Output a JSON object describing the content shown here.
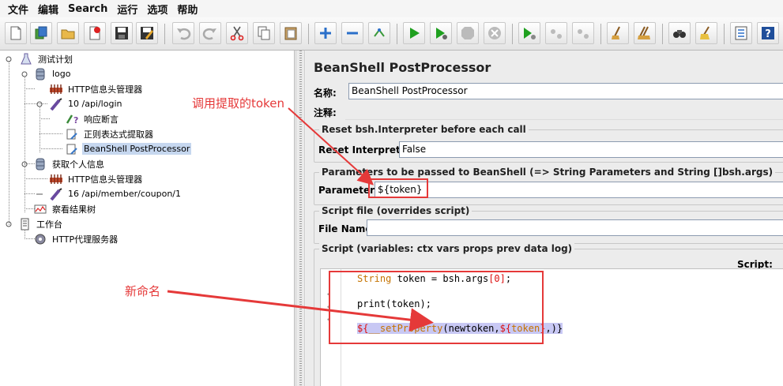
{
  "menu": {
    "items": [
      "文件",
      "编辑",
      "Search",
      "运行",
      "选项",
      "帮助"
    ]
  },
  "toolbar": {
    "icons": [
      "new-file-icon",
      "templates-icon",
      "open-icon",
      "close-plan-icon",
      "save-icon",
      "save-as-icon",
      "undo-icon",
      "redo-icon",
      "cut-icon",
      "copy-icon",
      "paste-icon",
      "expand-icon",
      "collapse-icon",
      "toggle-icon",
      "start-icon",
      "start-no-pause-icon",
      "stop-icon",
      "shutdown-icon",
      "remote-start-icon",
      "remote-stop-icon",
      "remote-shutdown-icon",
      "clear-icon",
      "clear-all-icon",
      "search-icon",
      "reset-search-icon",
      "function-helper-icon",
      "help-icon"
    ]
  },
  "tree": {
    "nodes": [
      {
        "label": "测试计划",
        "icon": "test-plan-icon"
      },
      {
        "label": "logo",
        "icon": "thread-group-icon"
      },
      {
        "label": "HTTP信息头管理器",
        "icon": "header-manager-icon"
      },
      {
        "label": "10 /api/login",
        "icon": "sampler-icon"
      },
      {
        "label": "响应断言",
        "icon": "assertion-icon"
      },
      {
        "label": "正则表达式提取器",
        "icon": "extractor-icon"
      },
      {
        "label": "BeanShell PostProcessor",
        "icon": "postprocessor-icon"
      },
      {
        "label": "获取个人信息",
        "icon": "thread-group-icon"
      },
      {
        "label": "HTTP信息头管理器",
        "icon": "header-manager-icon"
      },
      {
        "label": "16 /api/member/coupon/1",
        "icon": "sampler-icon"
      },
      {
        "label": "察看结果树",
        "icon": "listener-icon"
      },
      {
        "label": "工作台",
        "icon": "workbench-icon"
      },
      {
        "label": "HTTP代理服务器",
        "icon": "proxy-icon"
      }
    ],
    "selected": "BeanShell PostProcessor"
  },
  "panel": {
    "title": "BeanShell PostProcessor",
    "name_label": "名称:",
    "name_value": "BeanShell PostProcessor",
    "comments_label": "注释:",
    "comments_value": "",
    "reset_legend": "Reset bsh.Interpreter before each call",
    "reset_label": "Reset Interpreter:",
    "reset_value": "False",
    "params_legend": "Parameters to be passed to BeanShell (=> String Parameters and String []bsh.args)",
    "params_label": "Parameters:",
    "params_value": "${token}",
    "file_legend": "Script file (overrides script)",
    "file_label": "File Name:",
    "file_value": "",
    "script_legend": "Script (variables: ctx vars props prev data log)",
    "script_label": "Script:"
  },
  "script": {
    "line1_type": "String",
    "line1_rest": " token = bsh.args",
    "line1_index": "[0]",
    "line1_end": ";",
    "line2": "print(token);",
    "line3_a": "${",
    "line3_b": "__setProperty",
    "line3_c": "(newtoken,",
    "line3_d": "${",
    "line3_e": "token",
    "line3_f": "}",
    "line3_g": ",)}"
  },
  "annotations": {
    "top": "调用提取的token",
    "bottom": "新命名",
    "color": "#e53939"
  }
}
